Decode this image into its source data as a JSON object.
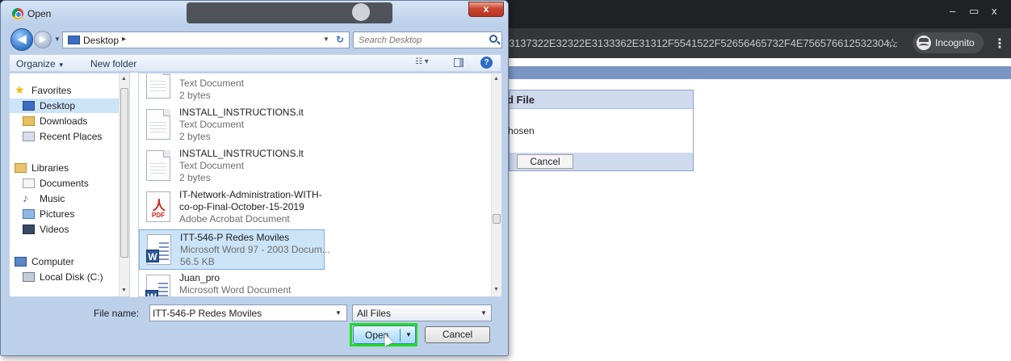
{
  "browser": {
    "url_fragment": "3137322E32322E3133362E31312F5541522F52656465732F4E756576612532304...",
    "incognito_label": "Incognito",
    "window_controls": [
      "–",
      "▭",
      "x"
    ]
  },
  "web_page": {
    "upload_title": "d File",
    "upload_status": "hosen",
    "cancel_label": "Cancel"
  },
  "dialog": {
    "title": "Open",
    "close_label": "x",
    "address": {
      "crumb": "Desktop"
    },
    "search": {
      "placeholder": "Search Desktop"
    },
    "toolbar": {
      "organize": "Organize",
      "new_folder": "New folder"
    },
    "nav": {
      "favorites": "Favorites",
      "desktop": "Desktop",
      "downloads": "Downloads",
      "recent_places": "Recent Places",
      "libraries": "Libraries",
      "documents": "Documents",
      "music": "Music",
      "pictures": "Pictures",
      "videos": "Videos",
      "computer": "Computer",
      "local_disk": "Local Disk (C:)"
    },
    "files": [
      {
        "name": "",
        "type": "Text Document",
        "size": "2 bytes",
        "icon": "text-document-icon"
      },
      {
        "name": "INSTALL_INSTRUCTIONS.it",
        "type": "Text Document",
        "size": "2 bytes",
        "icon": "text-document-icon"
      },
      {
        "name": "INSTALL_INSTRUCTIONS.lt",
        "type": "Text Document",
        "size": "2 bytes",
        "icon": "text-document-icon"
      },
      {
        "name": "IT-Network-Administration-WITH-",
        "name2": "co-op-Final-October-15-2019",
        "type": "Adobe Acrobat Document",
        "icon": "pdf-icon"
      },
      {
        "name": "ITT-546-P Redes Moviles",
        "type": "Microsoft Word 97 - 2003 Docum...",
        "size": "56.5 KB",
        "icon": "word-icon",
        "selected": true
      },
      {
        "name": "Juan_pro",
        "type": "Microsoft Word Document",
        "icon": "word-icon"
      }
    ],
    "file_name_label": "File name:",
    "file_name_value": "ITT-546-P Redes Moviles",
    "filter": "All Files",
    "open_label": "Open",
    "cancel_label": "Cancel"
  },
  "colors": {
    "highlight": "#22dd22",
    "selection": "#cce4f7",
    "chrome_dark": "#202124"
  }
}
